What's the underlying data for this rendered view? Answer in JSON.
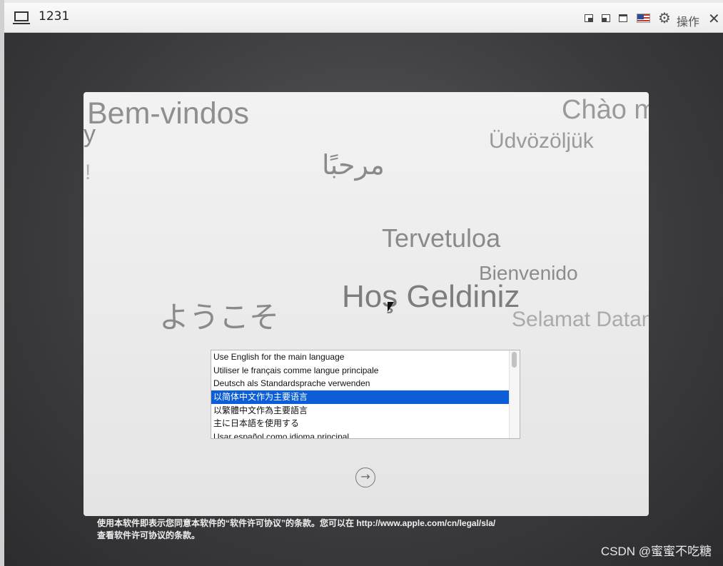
{
  "window": {
    "title": "1231",
    "action_label": "操作",
    "close_glyph": "✕",
    "gear_glyph": "⚙"
  },
  "welcome_words": [
    "Bem-vindos",
    "y",
    "!",
    "Chào m",
    "Üdvözöljük",
    "مرحبًا",
    "Tervetuloa",
    "Bienvenido",
    "Hoş Geldiniz",
    "ようこそ",
    "Selamat Datan"
  ],
  "language_list": {
    "items": [
      "Use English for the main language",
      "Utiliser le français comme langue principale",
      "Deutsch als Standardsprache verwenden",
      "以简体中文作为主要语言",
      "以繁體中文作為主要語言",
      "主に日本語を使用する",
      "Usar español como idioma principal"
    ],
    "selected_index": 3
  },
  "continue_glyph": "→",
  "license": {
    "line1": "使用本软件即表示您同意本软件的“软件许可协议”的条款。您可以在 http://www.apple.com/cn/legal/sla/",
    "line2": "查看软件许可协议的条款。"
  },
  "watermark": "CSDN @蜜蜜不吃糖",
  "colors": {
    "selection": "#0b5ed7",
    "desktop": "#3b3b3e"
  }
}
